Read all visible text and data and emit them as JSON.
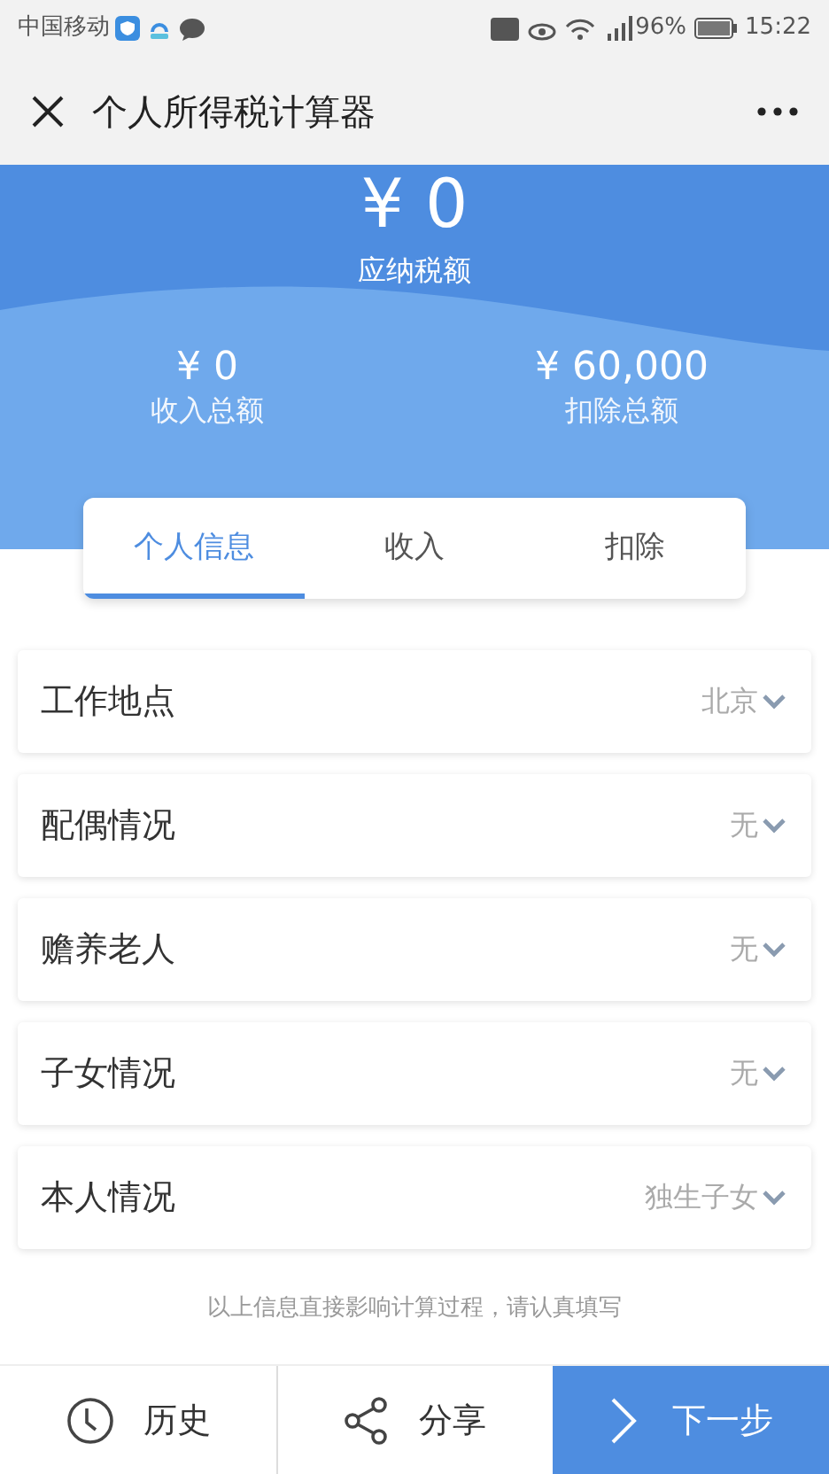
{
  "status_bar": {
    "carrier": "中国移动",
    "battery": "96%",
    "time": "15:22"
  },
  "nav": {
    "title": "个人所得税计算器"
  },
  "summary": {
    "tax_amount": "¥ 0",
    "tax_label": "应纳税额",
    "totals": [
      {
        "value": "¥ 0",
        "label": "收入总额"
      },
      {
        "value": "¥ 60,000",
        "label": "扣除总额"
      }
    ]
  },
  "tabs": [
    {
      "label": "个人信息",
      "selected": true
    },
    {
      "label": "收入",
      "selected": false
    },
    {
      "label": "扣除",
      "selected": false
    }
  ],
  "fields": [
    {
      "label": "工作地点",
      "value": "北京"
    },
    {
      "label": "配偶情况",
      "value": "无"
    },
    {
      "label": "赡养老人",
      "value": "无"
    },
    {
      "label": "子女情况",
      "value": "无"
    },
    {
      "label": "本人情况",
      "value": "独生子女"
    }
  ],
  "note": "以上信息直接影响计算过程，请认真填写",
  "actions": [
    {
      "kind": "history",
      "label": "历史"
    },
    {
      "kind": "share",
      "label": "分享"
    },
    {
      "kind": "next",
      "label": "下一步"
    }
  ]
}
